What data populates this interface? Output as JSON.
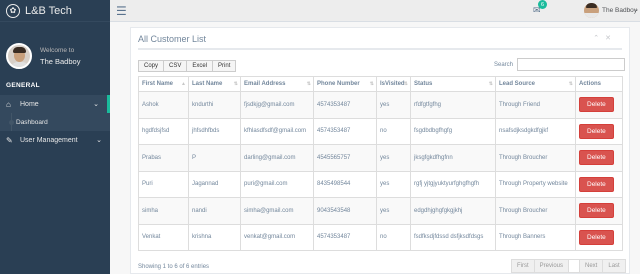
{
  "app": {
    "title": "L&B Tech"
  },
  "profile": {
    "welcome": "Welcome to",
    "name": "The Badboy"
  },
  "sidebar": {
    "section": "GENERAL",
    "items": [
      {
        "label": "Home",
        "icon": "home-icon"
      },
      {
        "label": "User Management",
        "icon": "edit-icon"
      }
    ],
    "subitems": [
      {
        "label": "Dashboard"
      }
    ]
  },
  "topbar": {
    "mail_count": "6",
    "user_name": "The Badboy"
  },
  "panel": {
    "title": "All Customer List"
  },
  "toolbar": {
    "copy": "Copy",
    "csv": "CSV",
    "excel": "Excel",
    "print": "Print",
    "search_label": "Search"
  },
  "table": {
    "headers": [
      "First Name",
      "Last Name",
      "Email Address",
      "Phone Number",
      "IsVisited",
      "Status",
      "Lead Source",
      "Actions"
    ],
    "rows": [
      [
        "Ashok",
        "kndurthi",
        "fjsdkjg@gmail.com",
        "4574353487",
        "yes",
        "rfdfgtfgfhg",
        "Through Friend",
        "Delete"
      ],
      [
        "hgdfdsjfsd",
        "jhfsdhfbds",
        "kfhlasdfsdf@gmail.com",
        "4574353487",
        "no",
        "fsgdbdbgfhgfg",
        "nsafsdjksdgkdfgjkf",
        "Delete"
      ],
      [
        "Prabas",
        "P",
        "darling@gmail.com",
        "4545565757",
        "yes",
        "jksgfgkdfhgfnn",
        "Through Broucher",
        "Delete"
      ],
      [
        "Puri",
        "Jagannad",
        "puri@gmail.com",
        "8435498544",
        "yes",
        "rgfj yjtgjyuktyurfghgfhgfh",
        "Through Property website",
        "Delete"
      ],
      [
        "simha",
        "nandi",
        "simha@gmail.com",
        "9043543548",
        "yes",
        "edgdhjghgfgkgjkhj",
        "Through Broucher",
        "Delete"
      ],
      [
        "Venkat",
        "krishna",
        "venkat@gmail.com",
        "4574353487",
        "no",
        "fsdfksdjfdssd dsfjksdfdsgs",
        "Through Banners",
        "Delete"
      ]
    ]
  },
  "footer": {
    "info": "Showing 1 to 6 of 6 entries",
    "first": "First",
    "previous": "Previous",
    "next": "Next",
    "last": "Last"
  }
}
